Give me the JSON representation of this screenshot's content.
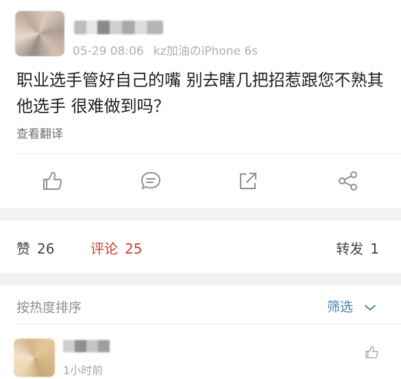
{
  "post": {
    "date": "05-29 08:06",
    "source": "kz加油のiPhone 6s",
    "text": "职业选手管好自己的嘴 别去瞎几把招惹跟您不熟其他选手 很难做到吗？",
    "translate_label": "查看翻译"
  },
  "actions": [
    {
      "icon": "thumbs-up-icon"
    },
    {
      "icon": "comment-icon"
    },
    {
      "icon": "repost-icon"
    },
    {
      "icon": "share-icon"
    }
  ],
  "stats": {
    "likes_label": "赞",
    "likes_count": "26",
    "comments_label": "评论",
    "comments_count": "25",
    "reposts_label": "转发",
    "reposts_count": "1"
  },
  "sort": {
    "label": "按热度排序",
    "filter_label": "筛选"
  },
  "comment": {
    "time": "1小时前"
  },
  "colors": {
    "accent_red": "#d9382a",
    "filter_blue": "#4a7fae",
    "icon_gray": "#8e8e8e"
  }
}
